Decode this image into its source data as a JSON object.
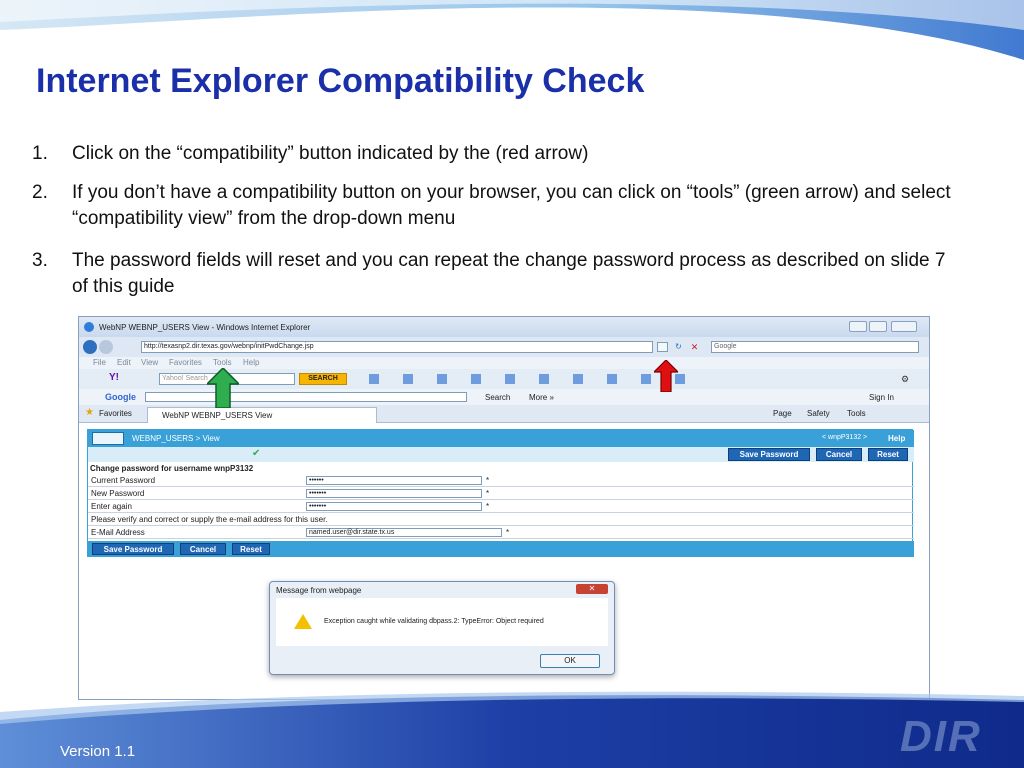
{
  "slide": {
    "title": "Internet Explorer Compatibility Check",
    "steps": [
      {
        "num": "1.",
        "text": "Click on the “compatibility” button indicated by the (red arrow)"
      },
      {
        "num": "2.",
        "text": "If you don’t have a compatibility button on your browser, you can click on “tools” (green arrow) and select “compatibility view” from the drop-down menu"
      },
      {
        "num": "3.",
        "text": "The password fields will reset and you can repeat the change password process as described on slide 7 of this guide"
      }
    ],
    "version": "Version 1.1",
    "logo_text": "DIR"
  },
  "browser": {
    "window_title": "WebNP WEBNP_USERS View - Windows Internet Explorer",
    "address": "http://texasnp2.dir.texas.gov/webnp/initPwdChange.jsp",
    "search_placeholder": "Google",
    "menu": [
      "File",
      "Edit",
      "View",
      "Favorites",
      "Tools",
      "Help"
    ],
    "yahoo_search_placeholder": "Yahoo! Search",
    "yahoo_search_button": "SEARCH",
    "google_logo": "Google",
    "google_search_label": "Search",
    "google_more_label": "More »",
    "sign_in_label": "Sign In",
    "favorites_label": "Favorites",
    "tab_label": "WebNP WEBNP_USERS View",
    "cmd_page": "Page",
    "cmd_safety": "Safety",
    "cmd_tools": "Tools"
  },
  "app": {
    "breadcrumb": "WEBNP_USERS > View",
    "user_nav": "< wnpP3132 >",
    "help": "Help",
    "save_password": "Save Password",
    "cancel": "Cancel",
    "reset": "Reset",
    "form_header": "Change password for username wnpP3132",
    "current_password_label": "Current Password",
    "current_password_value": "••••••",
    "new_password_label": "New Password",
    "new_password_value": "•••••••",
    "enter_again_label": "Enter again",
    "enter_again_value": "•••••••",
    "verify_note": "Please verify and correct or supply the e-mail address for this user.",
    "email_label": "E-Mail Address",
    "email_value": "named.user@dir.state.tx.us",
    "required_mark": "*"
  },
  "dialog": {
    "title": "Message from webpage",
    "message": "Exception caught while validating dbpass.2: TypeError: Object required",
    "ok": "OK"
  },
  "colors": {
    "title_blue": "#1a2fa8",
    "app_blue": "#3aa0d8",
    "button_blue": "#1f66b4",
    "red_arrow": "#e01010",
    "green_arrow": "#2eae4e"
  }
}
